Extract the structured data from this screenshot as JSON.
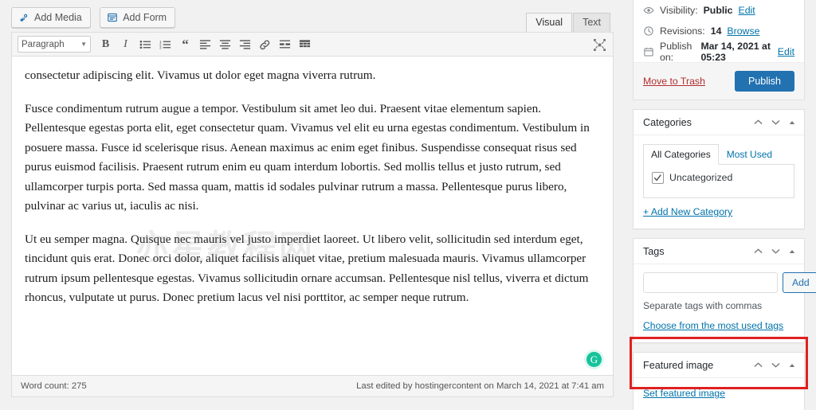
{
  "editor": {
    "media_buttons": [
      {
        "label": "Add Media",
        "icon": "media-icon"
      },
      {
        "label": "Add Form",
        "icon": "form-icon"
      }
    ],
    "mode_tabs": [
      {
        "label": "Visual",
        "active": true
      },
      {
        "label": "Text",
        "active": false
      }
    ],
    "format_select": {
      "value": "Paragraph",
      "caret": "▼"
    },
    "format_buttons": [
      {
        "name": "bold-icon",
        "glyph": "B"
      },
      {
        "name": "italic-icon",
        "glyph": "I"
      },
      {
        "name": "bulleted-list-icon",
        "glyph": ""
      },
      {
        "name": "numbered-list-icon",
        "glyph": ""
      },
      {
        "name": "blockquote-icon",
        "glyph": "“"
      },
      {
        "name": "align-left-icon",
        "glyph": ""
      },
      {
        "name": "align-center-icon",
        "glyph": ""
      },
      {
        "name": "align-right-icon",
        "glyph": ""
      },
      {
        "name": "insert-link-icon",
        "glyph": ""
      },
      {
        "name": "read-more-icon",
        "glyph": ""
      },
      {
        "name": "toolbar-toggle-icon",
        "glyph": ""
      }
    ],
    "fullscreen_button": {
      "name": "distraction-free-icon"
    },
    "watermark": "亦星教程网",
    "grammarly_badge": "G",
    "paragraphs": [
      "consectetur adipiscing elit. Vivamus ut dolor eget magna viverra rutrum.",
      "Fusce condimentum rutrum augue a tempor. Vestibulum sit amet leo dui. Praesent vitae elementum sapien. Pellentesque egestas porta elit, eget consectetur quam. Vivamus vel elit eu urna egestas condimentum. Vestibulum in posuere massa. Fusce id scelerisque risus. Aenean maximus ac enim eget finibus. Suspendisse consequat risus sed purus euismod facilisis. Praesent rutrum enim eu quam interdum lobortis. Sed mollis tellus et justo rutrum, sed ullamcorper turpis porta. Sed massa quam, mattis id sodales pulvinar rutrum a massa. Pellentesque purus libero, pulvinar ac varius ut, iaculis ac nisi.",
      "Ut eu semper magna. Quisque nec mauris vel justo imperdiet laoreet. Ut libero velit, sollicitudin sed interdum eget, tincidunt quis erat. Donec orci dolor, aliquet facilisis aliquet vitae, pretium malesuada mauris. Vivamus ullamcorper rutrum ipsum pellentesque egestas. Vivamus sollicitudin ornare accumsan. Pellentesque nisl tellus, viverra et dictum rhoncus, vulputate ut purus. Donec pretium lacus vel nisi porttitor, ac semper neque rutrum."
    ],
    "status": {
      "word_count": "Word count: 275",
      "last_edited": "Last edited by hostingercontent on March 14, 2021 at 7:41 am"
    }
  },
  "sidebar": {
    "publish": {
      "visibility": {
        "icon": "eye-icon",
        "label": "Visibility:",
        "value": "Public",
        "edit": "Edit"
      },
      "revisions": {
        "icon": "clock-icon",
        "label": "Revisions:",
        "value": "14",
        "browse": "Browse"
      },
      "schedule": {
        "icon": "calendar-icon",
        "label": "Publish on:",
        "value": "Mar 14, 2021 at 05:23",
        "edit": "Edit"
      },
      "trash_label": "Move to Trash",
      "publish_label": "Publish",
      "publish_color": "#2271b1",
      "trash_color": "#b32d2e"
    },
    "categories": {
      "title": "Categories",
      "tabs": [
        {
          "label": "All Categories",
          "active": true
        },
        {
          "label": "Most Used",
          "active": false
        }
      ],
      "items": [
        {
          "label": "Uncategorized",
          "checked": true
        }
      ],
      "add_new_link": "+ Add New Category",
      "controls": {
        "up": "up-arrow-icon",
        "down": "down-arrow-icon",
        "toggle": "collapse-toggle-icon"
      }
    },
    "tags": {
      "title": "Tags",
      "input_value": "",
      "input_placeholder": "",
      "add_label": "Add",
      "hint": "Separate tags with commas",
      "choose_link": "Choose from the most used tags"
    },
    "featured_image": {
      "title": "Featured image",
      "set_link": "Set featured image",
      "highlight_color": "#e02020"
    }
  }
}
